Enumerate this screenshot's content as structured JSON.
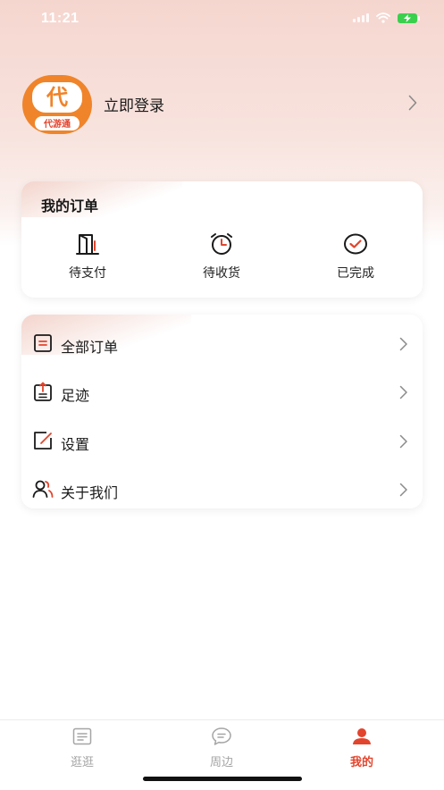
{
  "status_bar": {
    "time": "11:21"
  },
  "profile": {
    "login_label": "立即登录",
    "logo_text": "代",
    "logo_caption": "代游通"
  },
  "orders": {
    "title": "我的订单",
    "items": [
      {
        "label": "待支付",
        "icon": "door-icon"
      },
      {
        "label": "待收货",
        "icon": "alarm-clock-icon"
      },
      {
        "label": "已完成",
        "icon": "check-circle-icon"
      }
    ]
  },
  "menu": {
    "items": [
      {
        "label": "全部订单",
        "icon": "order-list-icon"
      },
      {
        "label": "足迹",
        "icon": "footprint-clipboard-icon"
      },
      {
        "label": "设置",
        "icon": "settings-edit-icon"
      },
      {
        "label": "关于我们",
        "icon": "users-icon"
      }
    ]
  },
  "tabbar": {
    "tabs": [
      {
        "label": "逛逛",
        "icon": "list-icon",
        "active": false
      },
      {
        "label": "周边",
        "icon": "chat-bubble-icon",
        "active": false
      },
      {
        "label": "我的",
        "icon": "person-icon",
        "active": true
      }
    ]
  },
  "colors": {
    "accent": "#e2452d",
    "logo_orange": "#f0842a",
    "inactive": "#a5a5a5"
  }
}
